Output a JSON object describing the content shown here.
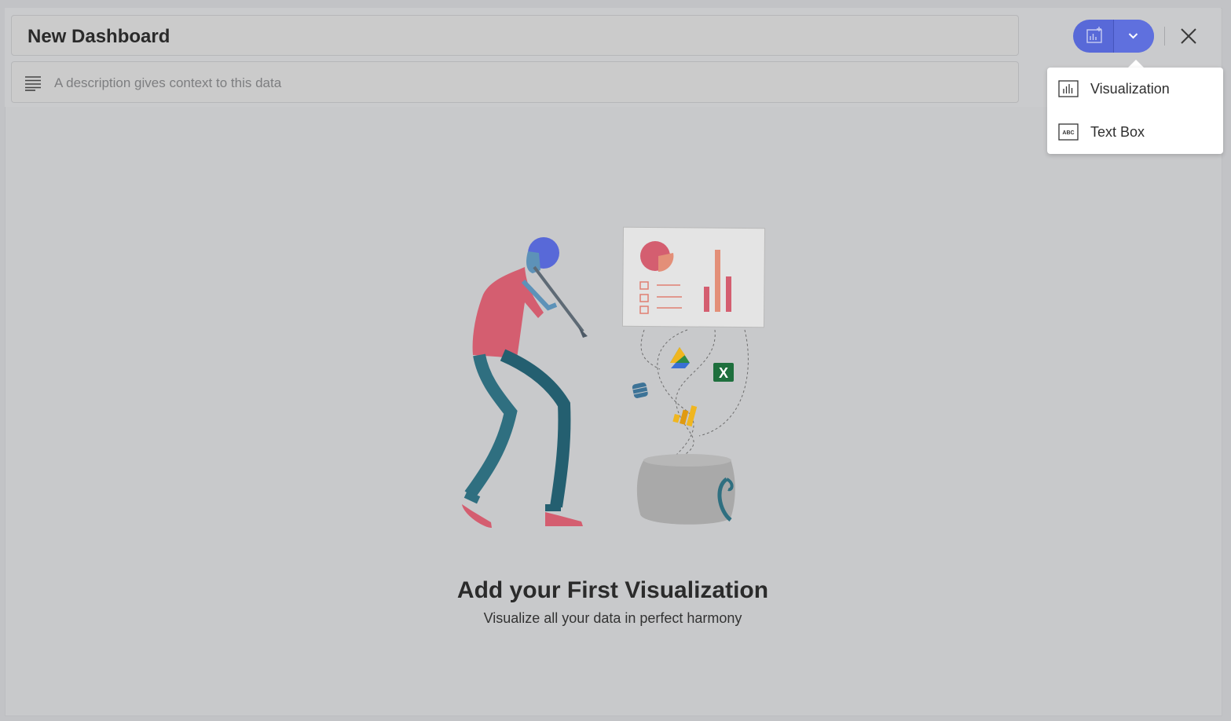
{
  "dashboard": {
    "title": "New Dashboard",
    "description_placeholder": "A description gives context to this data"
  },
  "toolbar": {
    "add_button_icon": "add-visualization-icon",
    "dropdown_icon": "chevron-down-icon",
    "close_icon": "close-icon",
    "accent_color": "#5869d8"
  },
  "add_menu": {
    "items": [
      {
        "label": "Visualization",
        "icon": "bar-chart-icon"
      },
      {
        "label": "Text Box",
        "icon": "text-box-icon",
        "icon_text": "ABC"
      }
    ]
  },
  "empty_state": {
    "title": "Add your First Visualization",
    "subtitle": "Visualize all your data in perfect harmony"
  }
}
